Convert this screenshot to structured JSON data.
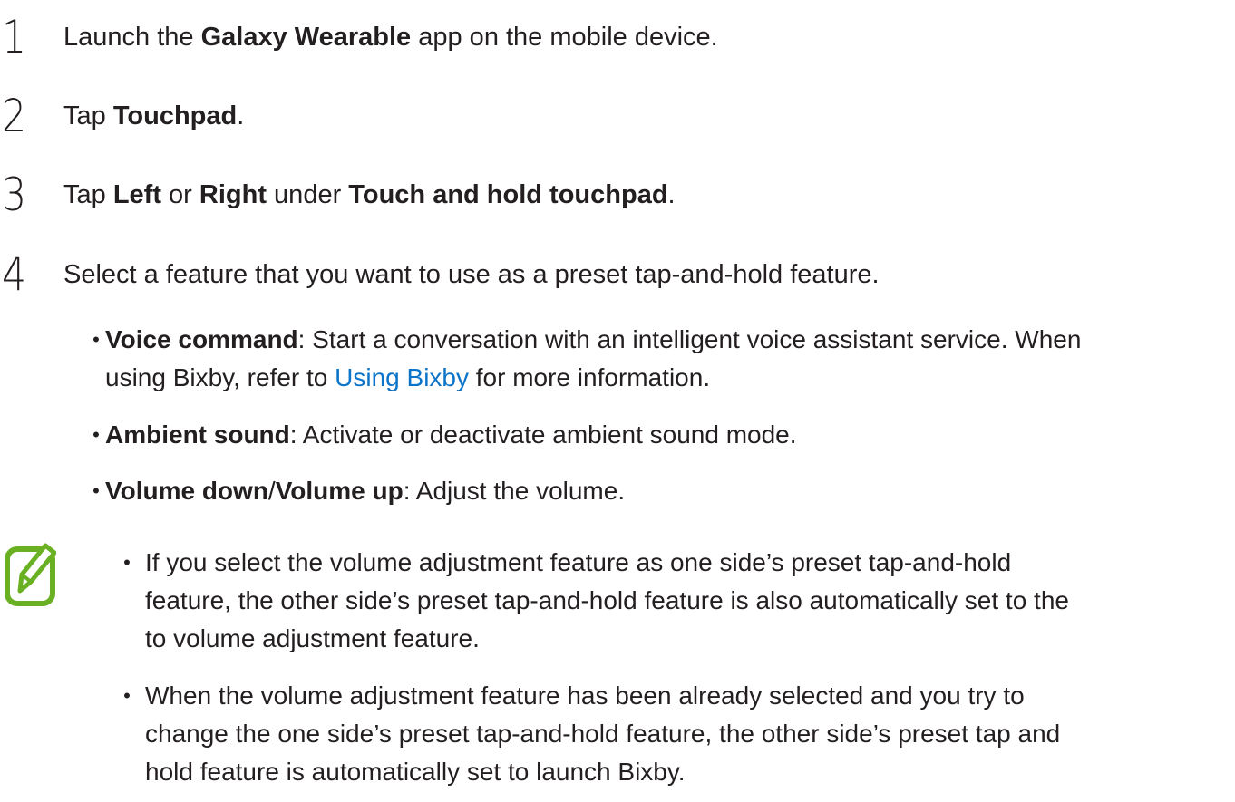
{
  "steps": [
    {
      "num": "1",
      "pre": "Launch the ",
      "b1": "Galaxy Wearable",
      "post": " app on the mobile device."
    },
    {
      "num": "2",
      "pre": "Tap ",
      "b1": "Touchpad",
      "post": "."
    },
    {
      "num": "3",
      "pre": "Tap ",
      "b1": "Left",
      "mid1": " or ",
      "b2": "Right",
      "mid2": " under ",
      "b3": "Touch and hold touchpad",
      "post": "."
    },
    {
      "num": "4",
      "text": "Select a feature that you want to use as a preset tap-and-hold feature."
    }
  ],
  "options": [
    {
      "bold": "Voice command",
      "text1": ": Start a conversation with an intelligent voice assistant service. When",
      "text2": "using Bixby, refer to ",
      "link": "Using Bixby",
      "text3": " for more information."
    },
    {
      "bold": "Ambient sound",
      "text1": ": Activate or deactivate ambient sound mode."
    },
    {
      "bold": "Volume down",
      "sep": "/",
      "bold2": "Volume up",
      "text1": ": Adjust the volume."
    }
  ],
  "notes": [
    {
      "line1": "If you select the volume adjustment feature as one side’s preset tap-and-hold",
      "line2": "feature, the other side’s preset tap-and-hold feature is also automatically set to the",
      "line3": "to volume adjustment feature."
    },
    {
      "line1": "When the volume adjustment feature has been already selected and you try to",
      "line2": "change the one side’s preset tap-and-hold feature, the other side’s preset tap and",
      "line3": "hold feature is automatically set to launch Bixby."
    }
  ],
  "bullet_char": "•",
  "colors": {
    "text": "#231f20",
    "link": "#0b74c9",
    "note_icon": "#6ab023"
  },
  "icons": {
    "note": "note-pencil-icon"
  }
}
